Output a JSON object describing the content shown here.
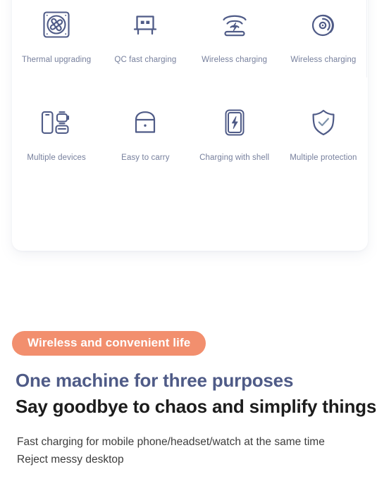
{
  "features": {
    "rows": [
      [
        {
          "icon": "fan-icon",
          "label": "Thermal upgrading"
        },
        {
          "icon": "usb-plug-icon",
          "label": "QC fast charging"
        },
        {
          "icon": "wireless-charging-pad-icon",
          "label": "Wireless charging"
        },
        {
          "icon": "wireless-signal-icon",
          "label": "Wireless charging"
        }
      ],
      [
        {
          "icon": "multiple-devices-icon",
          "label": "Multiple devices"
        },
        {
          "icon": "handbag-icon",
          "label": "Easy to carry"
        },
        {
          "icon": "phone-charging-icon",
          "label": "Charging with shell"
        },
        {
          "icon": "shield-check-icon",
          "label": "Multiple protection"
        }
      ]
    ]
  },
  "promo": {
    "pill_label": "Wireless and convenient life",
    "headline_primary": "One machine for three purposes",
    "headline_secondary": "Say goodbye to chaos and simplify things",
    "description_line_1": "Fast charging for mobile phone/headset/watch at the same time",
    "description_line_2": "Reject messy desktop"
  },
  "colors": {
    "icon_stroke": "#4f5b87",
    "label_text": "#767f9c",
    "pill_background": "#f28f6e",
    "headline_primary": "#4f5b87",
    "headline_secondary": "#1c1c1c",
    "card_background": "#ffffff",
    "page_background": "#ffffff"
  }
}
